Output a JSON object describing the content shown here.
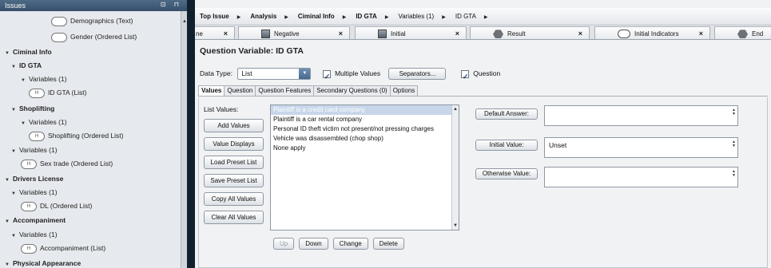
{
  "left_panel": {
    "title": "Issues",
    "controls": "⊡ ⊓",
    "tree": [
      {
        "label": "Demographics (Text)",
        "kind": "leaf"
      },
      {
        "label": "Gender (Ordered List)",
        "kind": "leaf"
      },
      {
        "label": "Ciminal Info",
        "kind": "group"
      },
      {
        "label": "ID GTA",
        "kind": "group"
      },
      {
        "label": "Variables (1)",
        "kind": "folder"
      },
      {
        "label": "ID GTA (List)",
        "kind": "leaf"
      },
      {
        "label": "Shoplifting",
        "kind": "group"
      },
      {
        "label": "Variables (1)",
        "kind": "folder"
      },
      {
        "label": "Shoplifting (Ordered List)",
        "kind": "leaf"
      },
      {
        "label": "Variables (1)",
        "kind": "folder"
      },
      {
        "label": "Sex trade (Ordered List)",
        "kind": "leaf"
      },
      {
        "label": "Drivers License",
        "kind": "group"
      },
      {
        "label": "Variables (1)",
        "kind": "folder"
      },
      {
        "label": "DL (Ordered List)",
        "kind": "leaf"
      },
      {
        "label": "Accompaniment",
        "kind": "group"
      },
      {
        "label": "Variables (1)",
        "kind": "folder"
      },
      {
        "label": "Accompaniment (List)",
        "kind": "leaf"
      },
      {
        "label": "Physical Appearance",
        "kind": "group"
      }
    ]
  },
  "breadcrumb": [
    "Top Issue",
    "Analysis",
    "Ciminal Info",
    "ID GTA",
    "Variables (1)",
    "ID GTA"
  ],
  "tabs": [
    {
      "label": "ne",
      "icon": ""
    },
    {
      "label": "Negative",
      "icon": "image-icon"
    },
    {
      "label": "Initial",
      "icon": "image-icon"
    },
    {
      "label": "Result",
      "icon": "hexagon-icon"
    },
    {
      "label": "Initial Indicators",
      "icon": "oval-icon"
    },
    {
      "label": "End",
      "icon": "hexagon-icon"
    }
  ],
  "question": {
    "title": "Question Variable:  ID GTA",
    "data_type_label": "Data Type:",
    "data_type_value": "List",
    "multiple_values_label": "Multiple Values",
    "separators_label": "Separators...",
    "question_label": "Question"
  },
  "subtabs": [
    "Values",
    "Question",
    "Question Features",
    "Secondary Questions  (0)",
    "Options"
  ],
  "values_panel": {
    "list_label": "List Values:",
    "buttons": [
      "Add Values",
      "Value Displays",
      "Load Preset List",
      "Save Preset List",
      "Copy All Values",
      "Clear All Values"
    ],
    "items": [
      "Plaintiff is a credit card company",
      "Plaintiff is a car rental company",
      "Personal ID theft victim not present/not pressing charges",
      "Vehicle was disassembled (chop shop)",
      "None apply"
    ],
    "bottom_buttons": [
      "Up",
      "Down",
      "Change",
      "Delete"
    ],
    "default_answer_label": "Default Answer:",
    "default_answer_value": "",
    "initial_value_label": "Initial Value:",
    "initial_value_value": "Unset",
    "otherwise_value_label": "Otherwise Value:",
    "otherwise_value_value": ""
  }
}
